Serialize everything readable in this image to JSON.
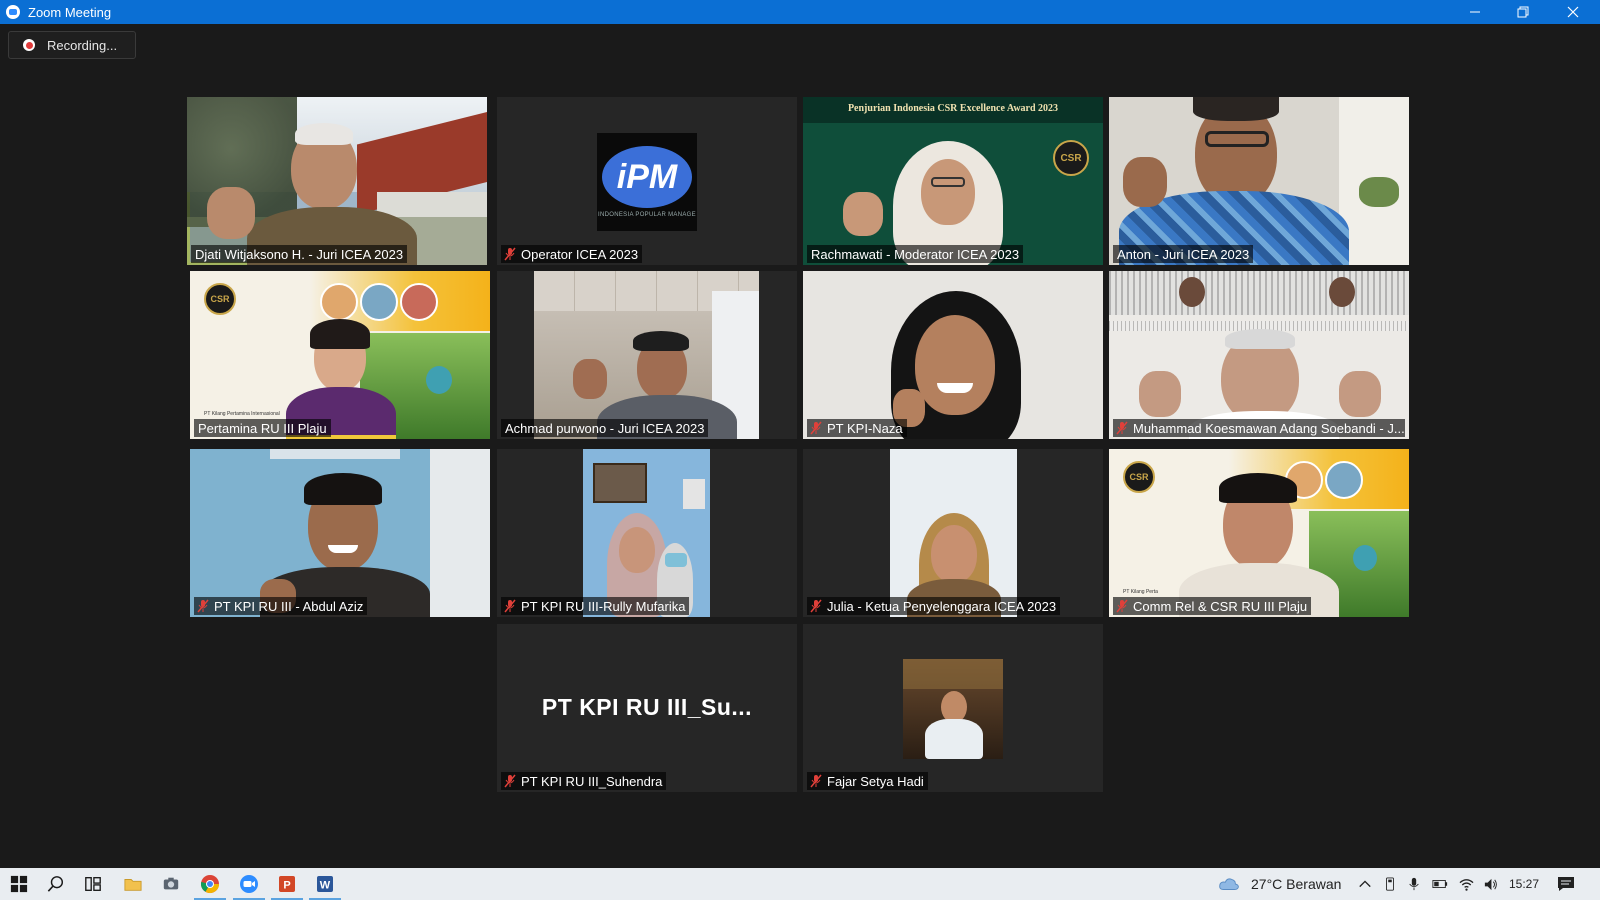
{
  "window": {
    "title": "Zoom Meeting"
  },
  "recording": {
    "label": "Recording..."
  },
  "participants": [
    {
      "name": "Djati Witjaksono H. - Juri ICEA 2023",
      "muted": false,
      "active": true
    },
    {
      "name": "Operator ICEA 2023",
      "muted": true,
      "logo_text": "iPM",
      "logo_caption": "INDONESIA POPULAR MANAGE"
    },
    {
      "name": "Rachmawati - Moderator ICEA 2023",
      "muted": false,
      "banner": "Penjurian Indonesia CSR Excellence Award 2023",
      "badge": "CSR"
    },
    {
      "name": "Anton - Juri ICEA 2023",
      "muted": false
    },
    {
      "name": "Pertamina RU III Plaju",
      "muted": false,
      "badge": "CSR",
      "corner_text": "PT Kilang Pertamina Internasional"
    },
    {
      "name": "Achmad purwono - Juri ICEA 2023",
      "muted": false
    },
    {
      "name": "PT KPI-Naza",
      "muted": true
    },
    {
      "name": "Muhammad Koesmawan Adang Soebandi - J...",
      "muted": true
    },
    {
      "name": "PT KPI RU III - Abdul Aziz",
      "muted": true
    },
    {
      "name": "PT KPI RU III-Rully Mufarika",
      "muted": true
    },
    {
      "name": "Julia - Ketua Penyelenggara ICEA 2023",
      "muted": true
    },
    {
      "name": "Comm Rel & CSR RU III Plaju",
      "muted": true,
      "badge": "CSR",
      "corner_text": "PT Kilang Perta"
    },
    {
      "name": "PT KPI RU III_Suhendra",
      "muted": true,
      "tile_text": "PT KPI RU III_Su..."
    },
    {
      "name": "Fajar Setya Hadi",
      "muted": true
    }
  ],
  "taskbar": {
    "weather": "27°C  Berawan",
    "time": "15:27"
  },
  "colors": {
    "titlebar": "#0b6fd4",
    "background": "#1a1a1a",
    "active_speaker": "#d9f06a",
    "muted_icon": "#e0403a"
  }
}
